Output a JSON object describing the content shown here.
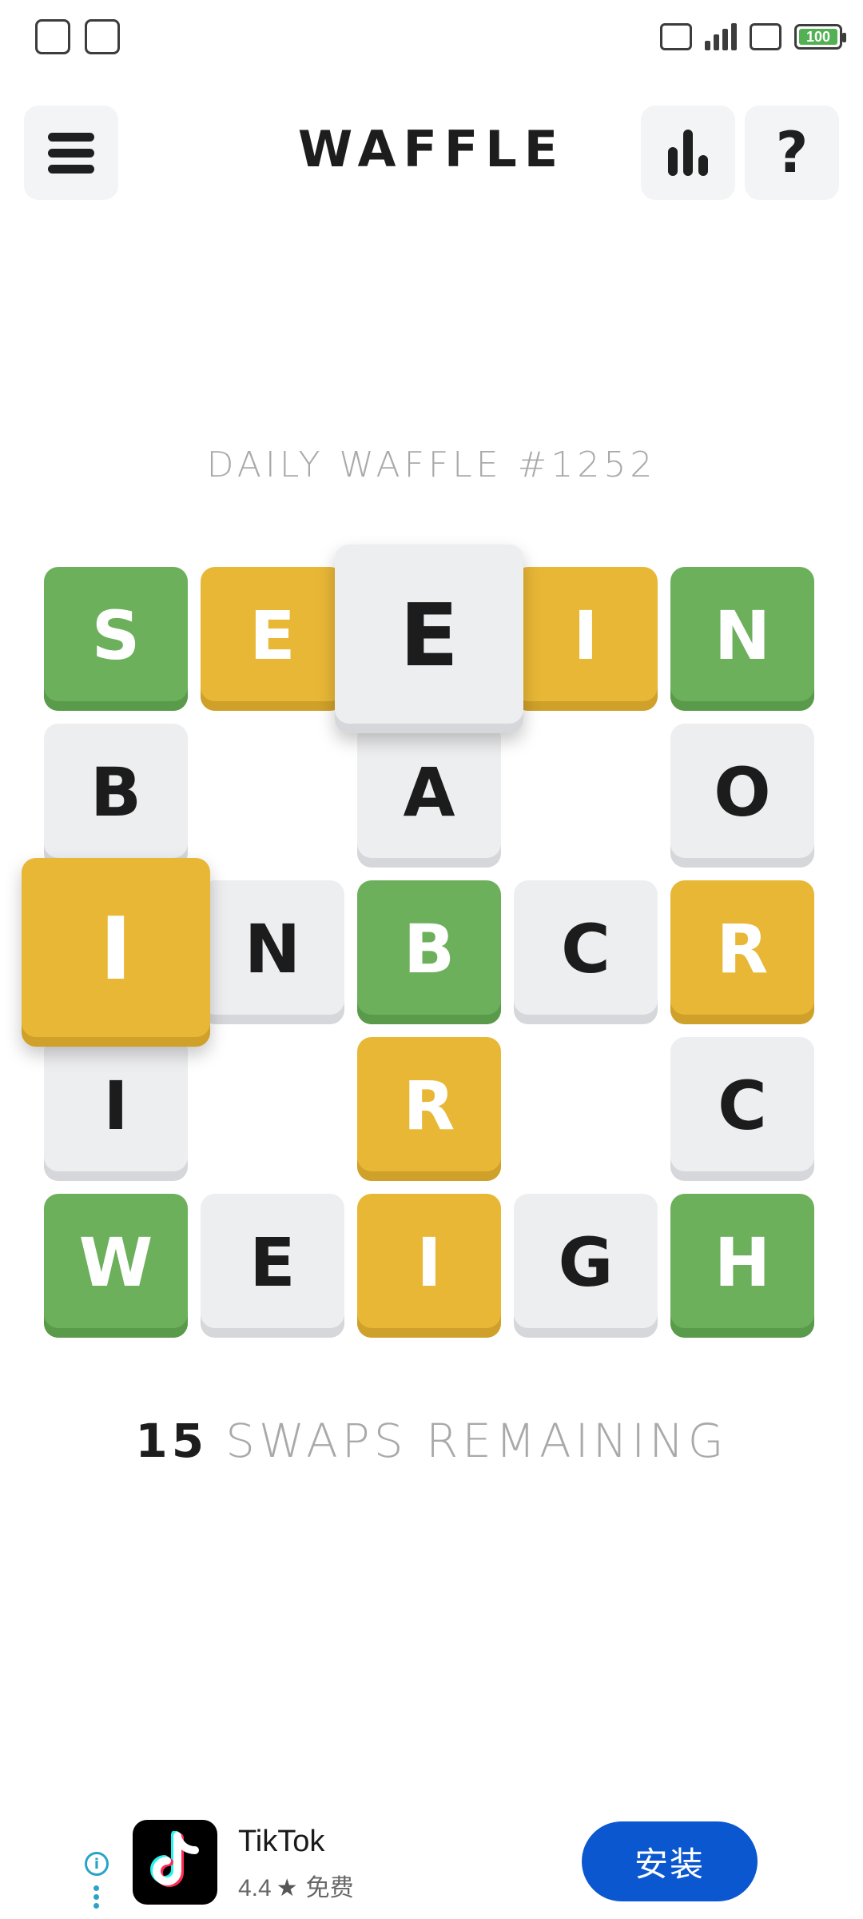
{
  "status_bar": {
    "time": "",
    "battery_percent": "100",
    "battery_color": "#53b153"
  },
  "header": {
    "title": "WAFFLE",
    "menu_icon": "hamburger-menu-icon",
    "stats_icon": "bar-chart-icon",
    "help_icon": "question-mark-icon",
    "help_glyph": "?"
  },
  "puzzle": {
    "label": "DAILY WAFFLE #1252",
    "colors": {
      "green": "#6cb05c",
      "yellow": "#e8b736",
      "grey": "#edeef0"
    },
    "tiles": [
      {
        "row": 0,
        "col": 0,
        "letter": "S",
        "state": "green"
      },
      {
        "row": 0,
        "col": 1,
        "letter": "E",
        "state": "yellow"
      },
      {
        "row": 0,
        "col": 2,
        "letter": "E",
        "state": "grey",
        "lifted": true
      },
      {
        "row": 0,
        "col": 3,
        "letter": "I",
        "state": "yellow"
      },
      {
        "row": 0,
        "col": 4,
        "letter": "N",
        "state": "green"
      },
      {
        "row": 1,
        "col": 0,
        "letter": "B",
        "state": "grey"
      },
      {
        "row": 1,
        "col": 2,
        "letter": "A",
        "state": "grey"
      },
      {
        "row": 1,
        "col": 4,
        "letter": "O",
        "state": "grey"
      },
      {
        "row": 2,
        "col": 0,
        "letter": "I",
        "state": "yellow",
        "lifted": true
      },
      {
        "row": 2,
        "col": 1,
        "letter": "N",
        "state": "grey"
      },
      {
        "row": 2,
        "col": 2,
        "letter": "B",
        "state": "green"
      },
      {
        "row": 2,
        "col": 3,
        "letter": "C",
        "state": "grey"
      },
      {
        "row": 2,
        "col": 4,
        "letter": "R",
        "state": "yellow"
      },
      {
        "row": 3,
        "col": 0,
        "letter": "I",
        "state": "grey"
      },
      {
        "row": 3,
        "col": 2,
        "letter": "R",
        "state": "yellow"
      },
      {
        "row": 3,
        "col": 4,
        "letter": "C",
        "state": "grey"
      },
      {
        "row": 4,
        "col": 0,
        "letter": "W",
        "state": "green"
      },
      {
        "row": 4,
        "col": 1,
        "letter": "E",
        "state": "grey"
      },
      {
        "row": 4,
        "col": 2,
        "letter": "I",
        "state": "yellow"
      },
      {
        "row": 4,
        "col": 3,
        "letter": "G",
        "state": "grey"
      },
      {
        "row": 4,
        "col": 4,
        "letter": "H",
        "state": "green"
      }
    ]
  },
  "swaps": {
    "count": "15",
    "label": "SWAPS REMAINING"
  },
  "ad": {
    "info_icon": "info-icon",
    "info_glyph": "i",
    "app_name": "TikTok",
    "rating": "4.4",
    "star_glyph": "★",
    "price": "免费",
    "install_label": "安装",
    "install_color": "#0b57d0"
  }
}
